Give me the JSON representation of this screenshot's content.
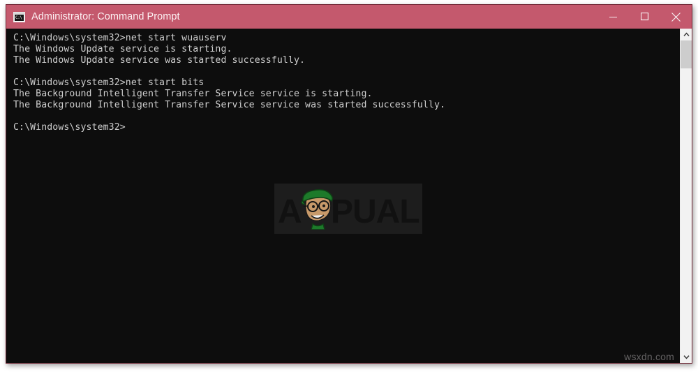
{
  "window": {
    "title": "Administrator: Command Prompt",
    "icon_name": "command-prompt-icon",
    "icon_text": "C:\\",
    "titlebar_color": "#c4596d",
    "border_color": "#6e2231",
    "background_color": "#0d0d0d",
    "text_color": "#cfcfcf"
  },
  "controls": {
    "minimize_label": "Minimize",
    "maximize_label": "Maximize",
    "close_label": "Close"
  },
  "console": {
    "lines": [
      "C:\\Windows\\system32>net start wuauserv",
      "The Windows Update service is starting.",
      "The Windows Update service was started successfully.",
      "",
      "C:\\Windows\\system32>net start bits",
      "The Background Intelligent Transfer Service service is starting.",
      "The Background Intelligent Transfer Service service was started successfully.",
      "",
      "C:\\Windows\\system32>"
    ]
  },
  "watermark": {
    "brand_text": "APPUALS",
    "brand_part_1": "A",
    "brand_part_2": "PUALS",
    "beret_color": "#1d7a2a",
    "skin_color": "#c89a6a",
    "letter_color": "#111111"
  },
  "corner_watermark": {
    "text": "wsxdn.com"
  },
  "scrollbar": {
    "up_arrow_name": "scroll-up-arrow",
    "down_arrow_name": "scroll-down-arrow",
    "thumb_name": "scroll-thumb"
  }
}
